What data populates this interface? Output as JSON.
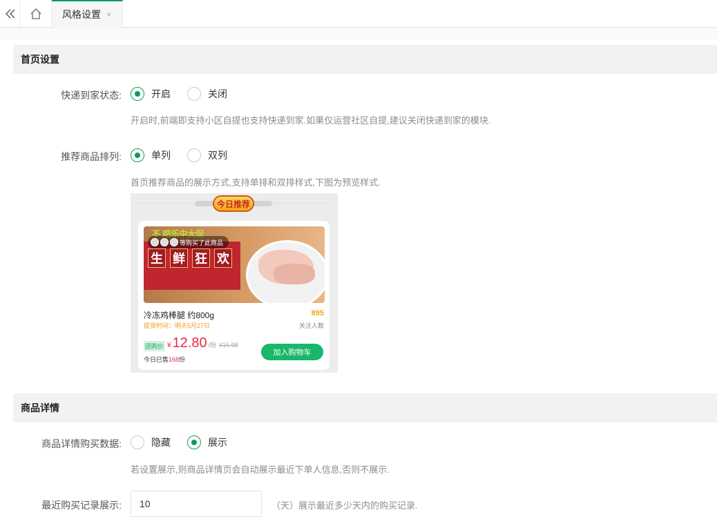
{
  "tabs": {
    "active_label": "风格设置",
    "close_glyph": "×"
  },
  "home_section": {
    "title": "首页设置",
    "delivery": {
      "label": "快递到家状态:",
      "options": [
        "开启",
        "关闭"
      ],
      "selected": "开启",
      "hint": "开启时,前端即支持小区自提也支持快递到家.如果仅运营社区自提,建议关闭快递到家的模块."
    },
    "layout": {
      "label": "推荐商品排列:",
      "options": [
        "单列",
        "双列"
      ],
      "selected": "单列",
      "hint": "首页推荐商品的展示方式,支持单排和双排样式,下图为预览样式."
    },
    "preview": {
      "badge": "今日推荐",
      "banner_headline": "不 吧乐中大促",
      "banner_title": [
        "生",
        "鲜",
        "狂",
        "欢"
      ],
      "buyers_text": "等购买了此商品",
      "product_name": "冷冻鸡棒腿  约800g",
      "pickup_time": "提货时间：明天5月27日",
      "follow_count": "895",
      "follow_label": "关注人数",
      "group_tag": "团购价",
      "currency": "¥",
      "price": "12.80",
      "unit": "/份",
      "old_price": "¥15.98",
      "sold_prefix": "今日已售",
      "sold_count": "168",
      "sold_suffix": "份",
      "cart_button": "加入购物车"
    }
  },
  "detail_section": {
    "title": "商品详情",
    "purchase_data": {
      "label": "商品详情购买数据:",
      "options": [
        "隐藏",
        "展示"
      ],
      "selected": "展示",
      "hint": "若设置展示,则商品详情页会自动展示最近下单人信息,否则不展示."
    },
    "recent_records": {
      "label": "最近购买记录展示:",
      "value": "10",
      "unit_hint": "（天）展示最近多少天内的购买记录."
    }
  },
  "icons": {
    "collapse": "double-chevron-left-icon",
    "home": "home-icon",
    "close": "close-icon"
  },
  "colors": {
    "accent": "#0f9a5c",
    "cart_button": "#18b76a",
    "price": "#e8294a",
    "section_header_bg": "#f2f2f2"
  }
}
